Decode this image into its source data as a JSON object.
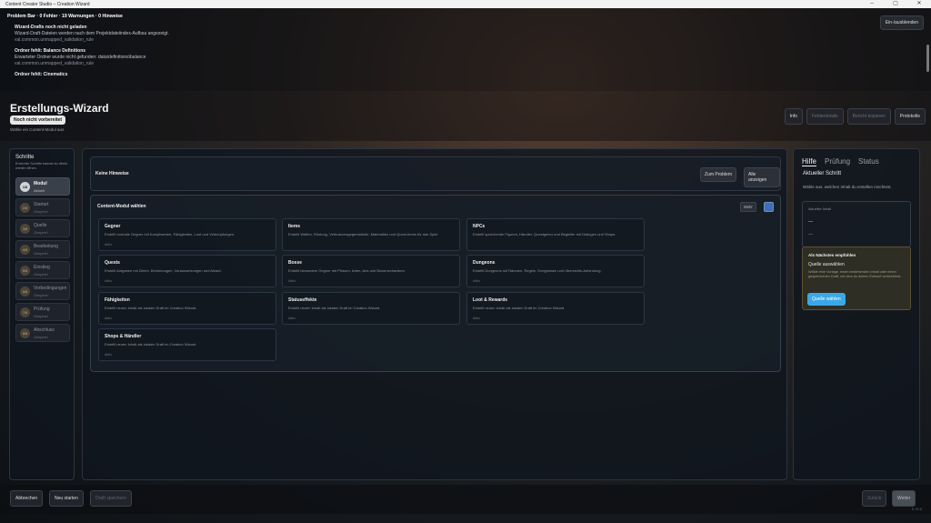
{
  "window": {
    "title": "Content Creator Studio – Creation Wizard"
  },
  "problem_bar": {
    "title": "Problem Bar · 0 Fehler · 19 Warnungen · 0 Hinweise",
    "toggle_label": "Ein-/ausblenden",
    "items": [
      {
        "title": "Wizard-Drafts noch nicht geladen",
        "desc": "Wizard-Draft-Dateien werden nach dem Projektdateiindex-Aufbau angezeigt.",
        "rule": "val.common.unmapped_validation_rule"
      },
      {
        "title": "Ordner fehlt: Balance Definitions",
        "desc": "Erwarteter Ordner wurde nicht gefunden: data\\definitions\\balance",
        "rule": "val.common.unmapped_validation_rule"
      },
      {
        "title": "Ordner fehlt: Cinematics",
        "desc": "",
        "rule": ""
      }
    ]
  },
  "header": {
    "title": "Erstellungs-Wizard",
    "badge": "Noch nicht vorbereitet",
    "subtitle": "Wähle ein Content-Modul aus.",
    "buttons": [
      {
        "label": "Info",
        "enabled": true
      },
      {
        "label": "Fehlerdetails",
        "enabled": false
      },
      {
        "label": "Bericht kopieren",
        "enabled": false
      },
      {
        "label": "Protokolle",
        "enabled": true
      }
    ]
  },
  "steps": {
    "title": "Schritte",
    "desc": "Erreichte Schritte kannst du direkt wieder öffnen.",
    "items": [
      {
        "num": "1/8",
        "label": "Modul",
        "status": "Aktuell",
        "active": true
      },
      {
        "num": "2/8",
        "label": "Startart",
        "status": "Gesperrt",
        "active": false
      },
      {
        "num": "3/8",
        "label": "Quelle",
        "status": "Gesperrt",
        "active": false
      },
      {
        "num": "4/8",
        "label": "Bearbeitung",
        "status": "Gesperrt",
        "active": false
      },
      {
        "num": "5/8",
        "label": "Einstieg",
        "status": "Gesperrt",
        "active": false
      },
      {
        "num": "6/8",
        "label": "Vorbedingungen",
        "status": "Gesperrt",
        "active": false
      },
      {
        "num": "7/8",
        "label": "Prüfung",
        "status": "Gesperrt",
        "active": false
      },
      {
        "num": "8/8",
        "label": "Abschluss",
        "status": "Gesperrt",
        "active": false
      }
    ]
  },
  "hints": {
    "title": "Keine Hinweise",
    "btn_problem": "Zum Problem",
    "btn_all": "Alle anzeigen"
  },
  "content_modules": {
    "title": "Content-Modul wählen",
    "more_label": "Mehr",
    "cards": [
      {
        "title": "Gegner",
        "desc": "Erstellt normale Gegner mit Kampfwerten, Fähigkeiten, Loot und Verknüpfungen.",
        "status": "Aktiv"
      },
      {
        "title": "Items",
        "desc": "Erstellt Waffen, Rüstung, Verbrauchsgegenstände, Materialien und Quest-Items für das Spiel.",
        "status": ""
      },
      {
        "title": "NPCs",
        "desc": "Erstellt sprechende Figuren, Händler, Questgeber und Begleiter mit Dialogen und Shops.",
        "status": ""
      },
      {
        "title": "Quests",
        "desc": "Erstellt Aufgaben mit Zielen, Belohnungen, Voraussetzungen und Ablauf.",
        "status": "Aktiv"
      },
      {
        "title": "Bosse",
        "desc": "Erstellt besondere Gegner mit Phasen, Arten, Arts und Bossmechaniken.",
        "status": "Aktiv"
      },
      {
        "title": "Dungeons",
        "desc": "Erstellt Dungeons mit Räumen, Regeln, Ereignissen und Übersichts-Anbindung.",
        "status": "Aktiv"
      },
      {
        "title": "Fähigkeiten",
        "desc": "Erstellt neuen Inhalt als lokalen Draft im Creation Wizard.",
        "status": "Aktiv"
      },
      {
        "title": "Statuseffekte",
        "desc": "Erstellt neuen Inhalt als lokalen Draft im Creation Wizard.",
        "status": "Aktiv"
      },
      {
        "title": "Loot & Rewards",
        "desc": "Erstellt neuen Inhalt als lokalen Draft im Creation Wizard.",
        "status": "Aktiv"
      },
      {
        "title": "Shops & Händler",
        "desc": "Erstellt neuen Inhalt als lokalen Draft im Creation Wizard.",
        "status": "Aktiv"
      }
    ]
  },
  "help": {
    "tabs": [
      "Hilfe",
      "Prüfung",
      "Status"
    ],
    "current_step": "Aktueller Schritt",
    "desc": "Wähle aus, welchen Inhalt du erstellen möchtest.",
    "current_content_label": "Aktueller Inhalt",
    "current_content_value": "—",
    "current_content_extra": "—",
    "rec_title": "Als Nächstes empfohlen",
    "rec_sub": "Quelle auswählen",
    "rec_desc": "Wähle eine Vorlage, einen bestehenden Inhalt oder einen gespeicherten Draft, mit dem du deinen Entwurf vorbereitest.",
    "rec_button": "Quelle wählen"
  },
  "footer": {
    "cancel": "Abbrechen",
    "restart": "Neu starten",
    "save": "Draft speichern",
    "back": "Zurück",
    "next": "Weiter",
    "version": "0.13.0"
  }
}
